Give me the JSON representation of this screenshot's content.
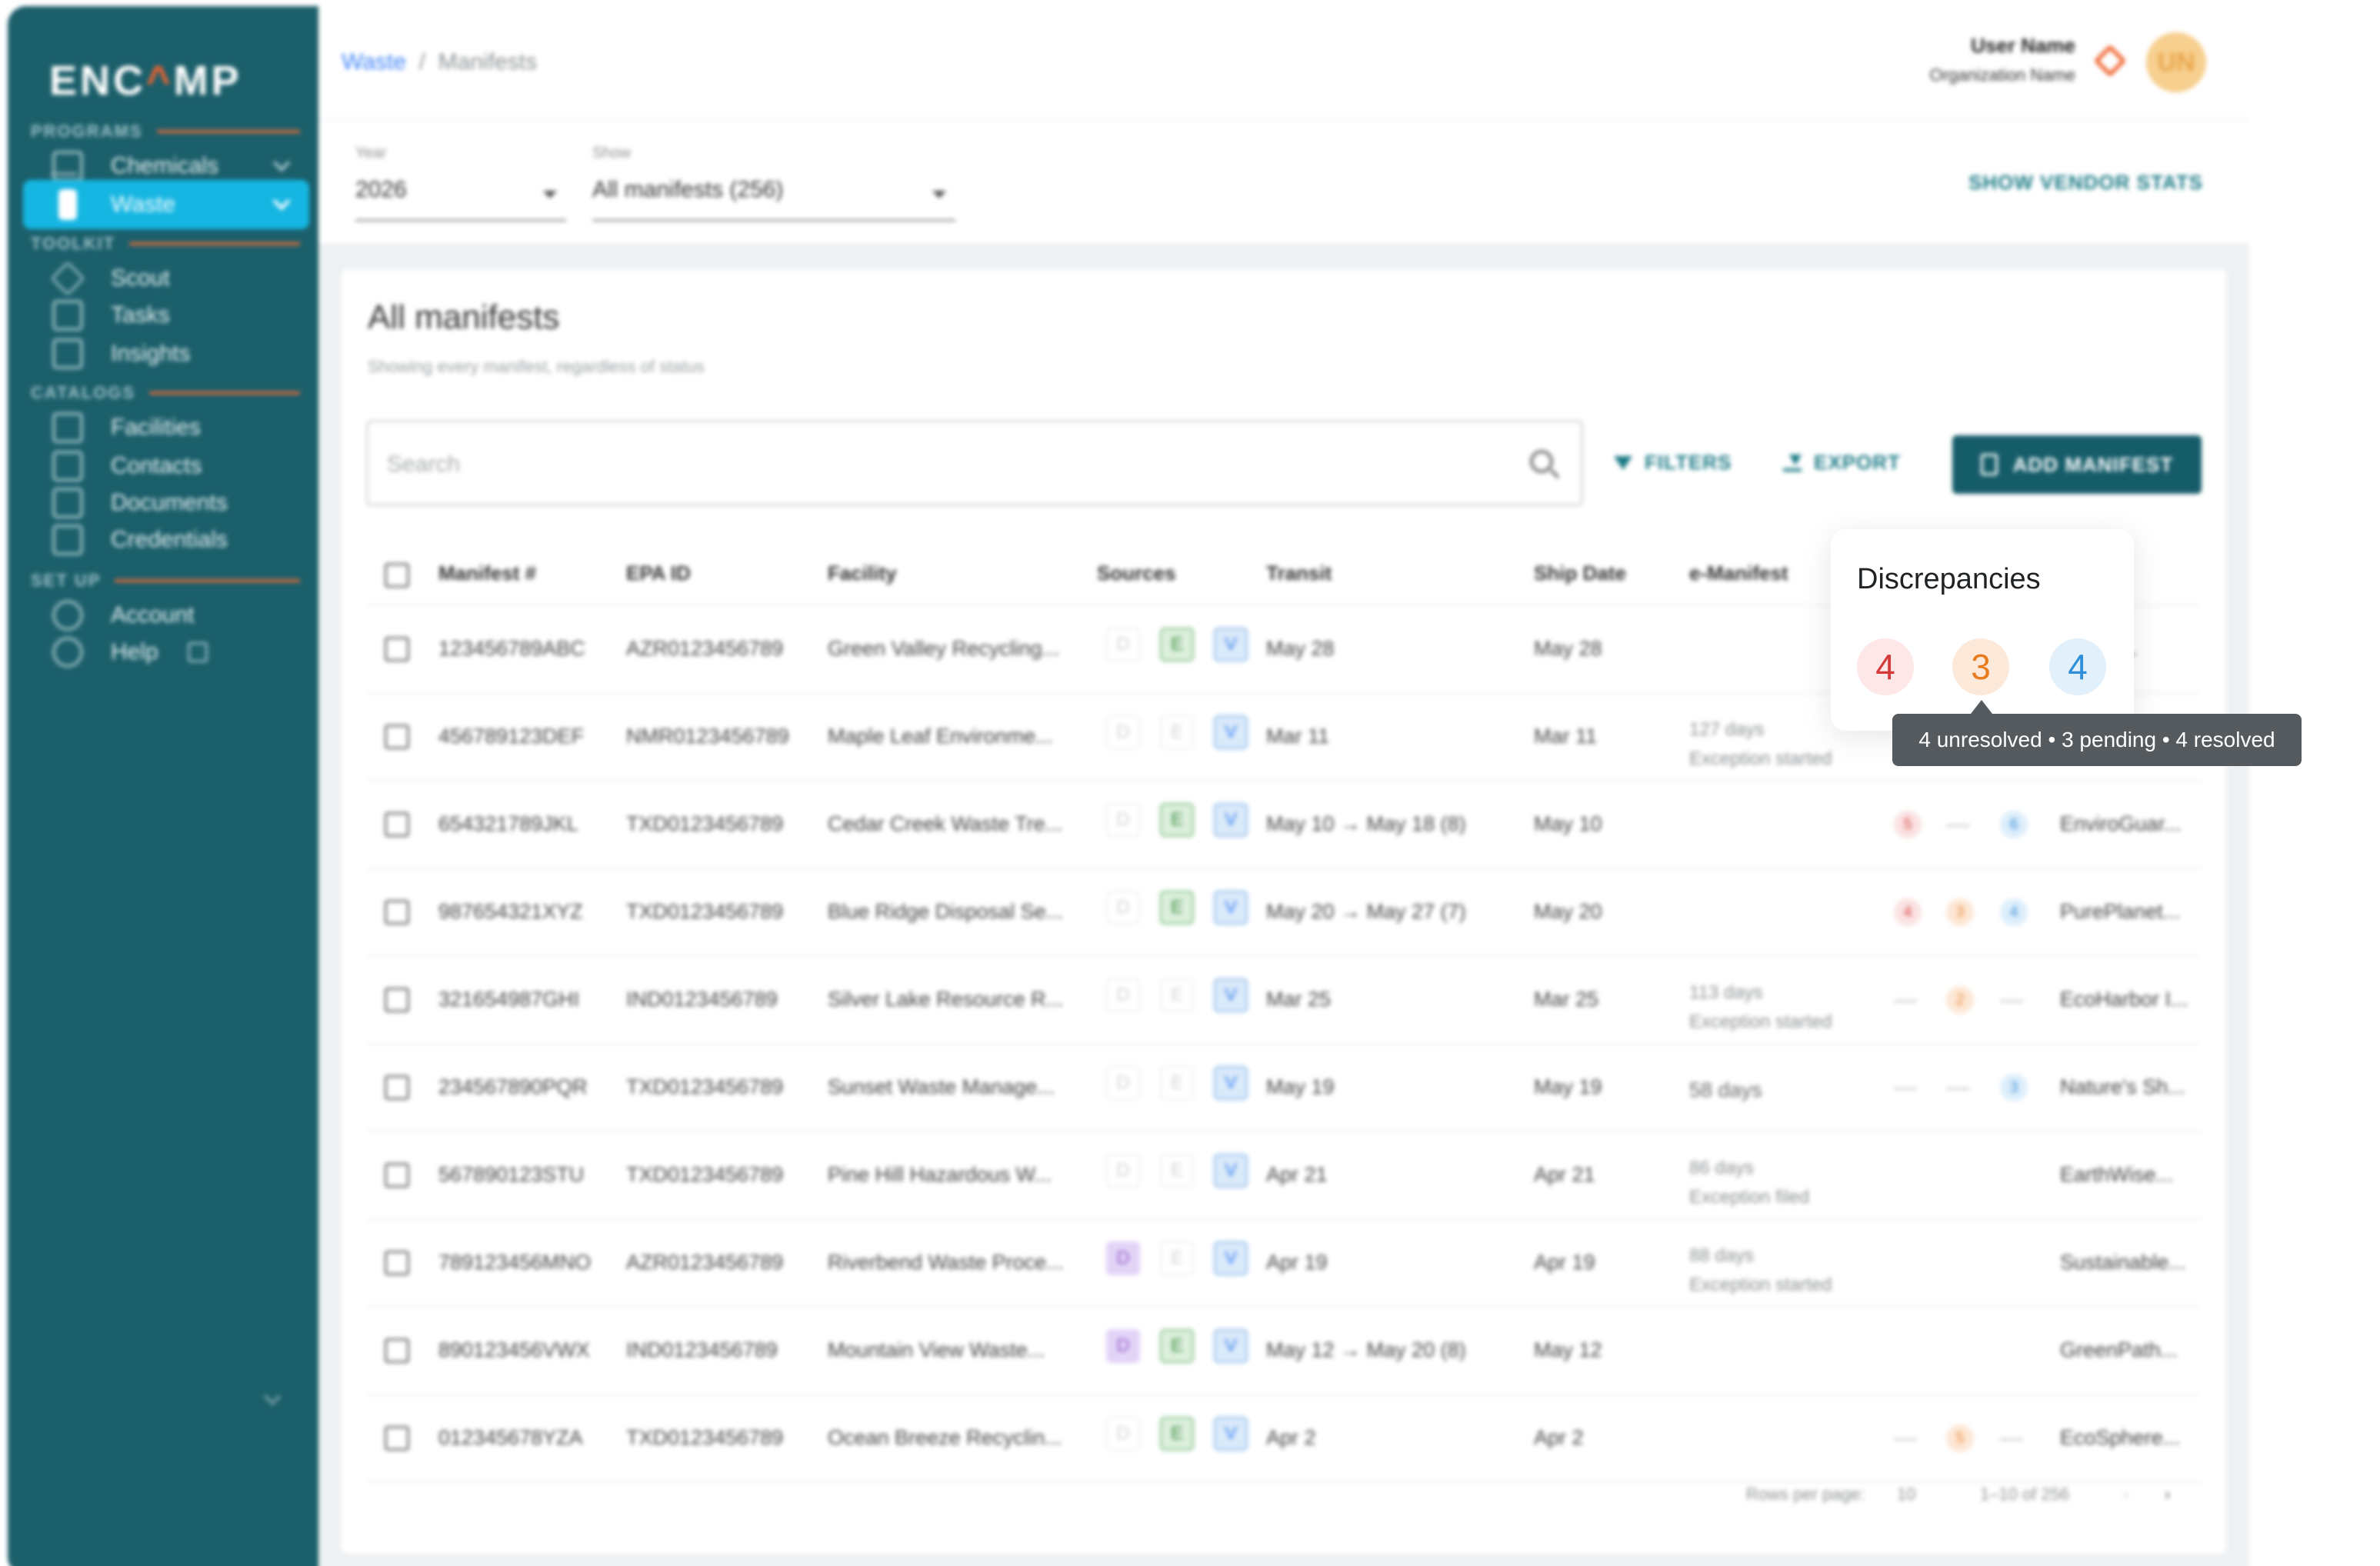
{
  "brand": {
    "logo": "ENCAMP",
    "accent": "#f0632f",
    "sidebar_bg": "#1b5f6b",
    "active_bg": "#16b6e2"
  },
  "sidebar": {
    "sections": [
      "PROGRAMS",
      "TOOLKIT",
      "CATALOGS",
      "SET UP"
    ],
    "items": [
      {
        "label": "Chemicals",
        "icon": "building-icon"
      },
      {
        "label": "Waste",
        "icon": "waste-bin-icon",
        "active": true
      },
      {
        "label": "Scout",
        "icon": "scout-icon"
      },
      {
        "label": "Tasks",
        "icon": "tasks-icon"
      },
      {
        "label": "Insights",
        "icon": "insights-icon"
      },
      {
        "label": "Facilities",
        "icon": "facilities-icon"
      },
      {
        "label": "Contacts",
        "icon": "contacts-icon"
      },
      {
        "label": "Documents",
        "icon": "documents-icon"
      },
      {
        "label": "Credentials",
        "icon": "credentials-icon"
      },
      {
        "label": "Account",
        "icon": "gear-icon"
      },
      {
        "label": "Help",
        "icon": "help-icon"
      }
    ]
  },
  "header": {
    "breadcrumb": {
      "root": "Waste",
      "sep": "/",
      "current": "Manifests"
    },
    "user": {
      "name": "User Name",
      "org": "Organization Name",
      "initials": "UN"
    }
  },
  "filters": {
    "year": {
      "label": "Year",
      "value": "2026"
    },
    "show": {
      "label": "Show",
      "value": "All manifests (256)"
    },
    "vendor_stats": "SHOW VENDOR STATS"
  },
  "main": {
    "title": "All manifests",
    "subtitle": "Showing every manifest, regardless of status",
    "search_placeholder": "Search",
    "filters_label": "FILTERS",
    "export_label": "EXPORT",
    "add_label": "ADD MANIFEST"
  },
  "table": {
    "columns": [
      "Manifest #",
      "EPA ID",
      "Facility",
      "Sources",
      "Transit",
      "Ship Date",
      "e-Manifest"
    ],
    "source_letters": [
      "D",
      "E",
      "V"
    ],
    "rows": [
      {
        "manifest": "123456789ABC",
        "epa": "AZR0123456789",
        "facility": "Green Valley Recycling...",
        "src": [
          "off",
          "e",
          "v"
        ],
        "transit": "May 28",
        "ship": "May 28",
        "emf1": "",
        "emf2": "",
        "disc": [],
        "vendor": "...e So..."
      },
      {
        "manifest": "456789123DEF",
        "epa": "NMR0123456789",
        "facility": "Maple Leaf Environme...",
        "src": [
          "off",
          "off",
          "v"
        ],
        "transit": "Mar 11",
        "ship": "Mar 11",
        "emf1": "127 days",
        "emf2": "Exception started",
        "disc": [],
        "vendor": ""
      },
      {
        "manifest": "654321789JKL",
        "epa": "TXD0123456789",
        "facility": "Cedar Creek Waste Tre...",
        "src": [
          "off",
          "e",
          "v"
        ],
        "transit": "May 10 → May 18 (8)",
        "ship": "May 10",
        "emf1": "",
        "emf2": "",
        "disc": [
          [
            "r",
            "5"
          ],
          [
            "dash",
            ""
          ],
          [
            "b",
            "6"
          ]
        ],
        "vendor": "EnviroGuar..."
      },
      {
        "manifest": "987654321XYZ",
        "epa": "TXD0123456789",
        "facility": "Blue Ridge Disposal Se...",
        "src": [
          "off",
          "e",
          "v"
        ],
        "transit": "May 20 → May 27 (7)",
        "ship": "May 20",
        "emf1": "",
        "emf2": "",
        "disc": [
          [
            "r",
            "4"
          ],
          [
            "o",
            "3"
          ],
          [
            "b",
            "4"
          ]
        ],
        "vendor": "PurePlanet..."
      },
      {
        "manifest": "321654987GHI",
        "epa": "IND0123456789",
        "facility": "Silver Lake Resource R...",
        "src": [
          "off",
          "off",
          "v"
        ],
        "transit": "Mar 25",
        "ship": "Mar 25",
        "emf1": "113 days",
        "emf2": "Exception started",
        "disc": [
          [
            "dash",
            ""
          ],
          [
            "o",
            "2"
          ],
          [
            "dash",
            ""
          ]
        ],
        "vendor": "EcoHarbor I..."
      },
      {
        "manifest": "234567890PQR",
        "epa": "TXD0123456789",
        "facility": "Sunset Waste Manage...",
        "src": [
          "off",
          "off",
          "v"
        ],
        "transit": "May 19",
        "ship": "May 19",
        "emf1": "58 days",
        "emf2": "",
        "disc": [
          [
            "dash",
            ""
          ],
          [
            "dash",
            ""
          ],
          [
            "b",
            "3"
          ]
        ],
        "vendor": "Nature's Sh..."
      },
      {
        "manifest": "567890123STU",
        "epa": "TXD0123456789",
        "facility": "Pine Hill Hazardous W...",
        "src": [
          "off",
          "off",
          "v"
        ],
        "transit": "Apr 21",
        "ship": "Apr 21",
        "emf1": "86 days",
        "emf2": "Exception filed",
        "disc": [],
        "vendor": "EarthWise..."
      },
      {
        "manifest": "789123456MNO",
        "epa": "AZR0123456789",
        "facility": "Riverbend Waste Proce...",
        "src": [
          "d",
          "off",
          "v"
        ],
        "transit": "Apr 19",
        "ship": "Apr 19",
        "emf1": "88 days",
        "emf2": "Exception started",
        "disc": [],
        "vendor": "Sustainable..."
      },
      {
        "manifest": "890123456VWX",
        "epa": "IND0123456789",
        "facility": "Mountain View Waste...",
        "src": [
          "d",
          "e",
          "v"
        ],
        "transit": "May 12 → May 20 (8)",
        "ship": "May 12",
        "emf1": "",
        "emf2": "",
        "disc": [],
        "vendor": "GreenPath..."
      },
      {
        "manifest": "012345678YZA",
        "epa": "TXD0123456789",
        "facility": "Ocean Breeze Recyclin...",
        "src": [
          "off",
          "e",
          "v"
        ],
        "transit": "Apr 2",
        "ship": "Apr 2",
        "emf1": "",
        "emf2": "",
        "disc": [
          [
            "dash",
            ""
          ],
          [
            "o",
            "5"
          ],
          [
            "dash",
            ""
          ]
        ],
        "vendor": "EcoSphere..."
      }
    ],
    "footer": {
      "rows_label": "Rows per page:",
      "rows_value": "10",
      "range": "1–10 of 256"
    }
  },
  "popover": {
    "title": "Discrepancies",
    "unresolved": "4",
    "pending": "3",
    "resolved": "4",
    "tooltip": "4 unresolved • 3 pending • 4 resolved"
  }
}
